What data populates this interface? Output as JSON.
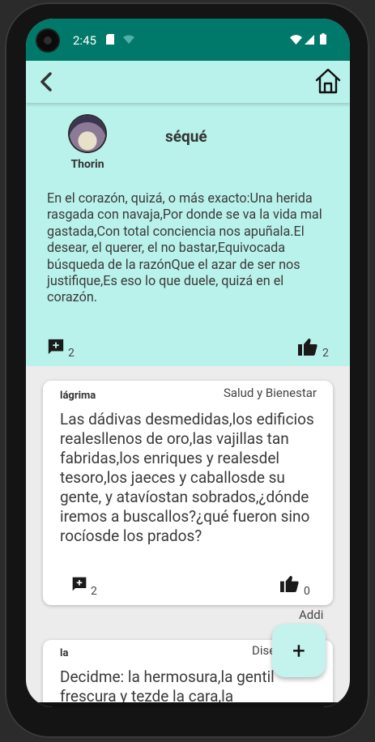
{
  "status_bar": {
    "time": "2:45",
    "icons": [
      "sd-card-icon",
      "wifi-icon",
      "signal-icon",
      "battery-icon"
    ]
  },
  "app_bar": {
    "back_icon": "chevron-left-icon",
    "home_icon": "home-icon"
  },
  "post": {
    "author": "Thorin",
    "title": "séqué",
    "body": "En el corazón, quizá, o más exacto:Una herida rasgada con navaja,Por donde se va la vida mal gastada,Con total conciencia nos apuñala.El desear, el querer, el no bastar,Equivocada búsqueda de la razónQue el azar de ser nos justifique,Es eso lo que duele, quizá en el corazón.",
    "comments": "2",
    "likes": "2"
  },
  "cards": [
    {
      "user": "lágrima",
      "category": "Salud y Bienestar",
      "body": "Las dádivas desmedidas,los edificios realesllenos de oro,las vajillas tan fabridas,los enriques y realesdel tesoro,los jaeces y caballosde su gente, y atavíostan sobrados,¿dónde iremos a buscallos?¿qué fueron sino rocíosde los prados?",
      "comments": "2",
      "likes": "0"
    },
    {
      "user": "la",
      "category": "Diseño",
      "body": "Decidme: la hermosura,la gentil frescura y tezde la cara,la"
    }
  ],
  "addi_label": "Addi",
  "fab": {
    "label": "+"
  }
}
